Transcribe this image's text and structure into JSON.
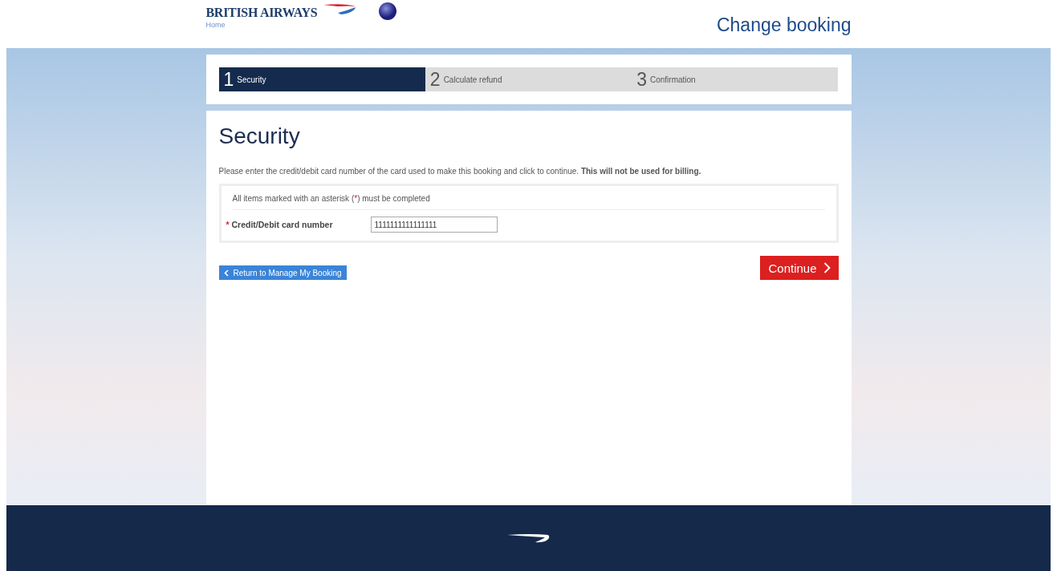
{
  "header": {
    "brand": "BRITISH AIRWAYS",
    "home_link": "Home",
    "page_title": "Change booking"
  },
  "steps": [
    {
      "number": "1",
      "label": "Security",
      "selected": true
    },
    {
      "number": "2",
      "label": "Calculate refund",
      "selected": false
    },
    {
      "number": "3",
      "label": "Confirmation",
      "selected": false
    }
  ],
  "heading": "Security",
  "intro": "Please enter the credit/debit card number of the card used to make this booking and click to continue. **This will not be used for billing.**",
  "note": [
    {
      "kind": "text",
      "text": "All items marked with an asterisk ("
    },
    {
      "kind": "required",
      "text": "*"
    },
    {
      "kind": "text",
      "text": ") must be completed"
    }
  ],
  "field": {
    "required_mark": "*",
    "label": "Credit/Debit card number",
    "value": "1111111111111111"
  },
  "buttons": {
    "back": "Return to Manage My Booking",
    "continue": "Continue"
  }
}
